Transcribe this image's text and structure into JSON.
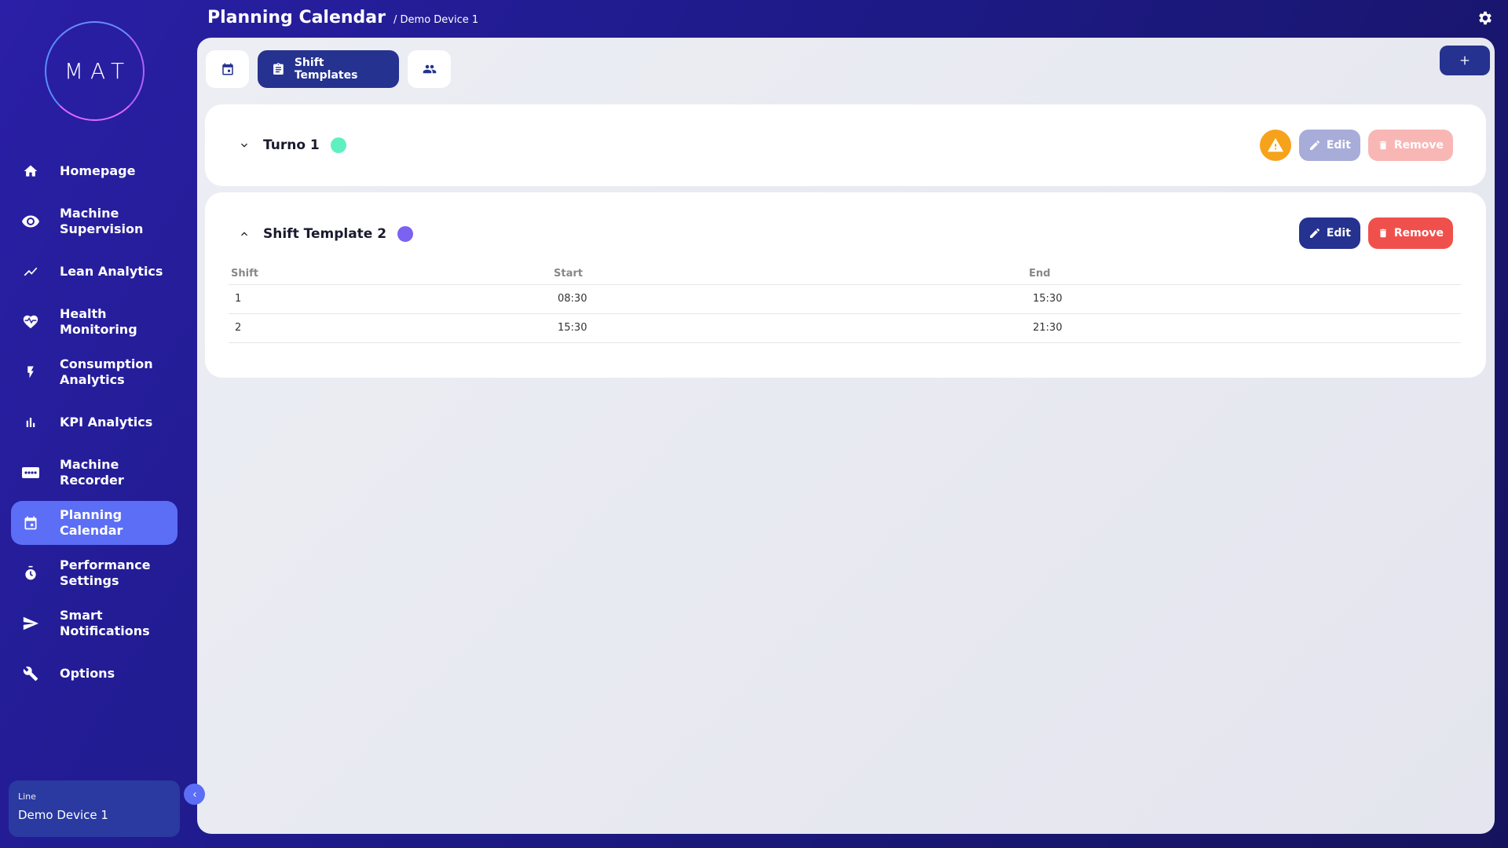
{
  "logo_text": "MAT",
  "sidebar": {
    "items": [
      {
        "label": "Homepage",
        "icon": "home-icon"
      },
      {
        "label": "Machine Supervision",
        "icon": "eye-icon"
      },
      {
        "label": "Lean Analytics",
        "icon": "trend-line-icon"
      },
      {
        "label": "Health Monitoring",
        "icon": "heart-pulse-icon"
      },
      {
        "label": "Consumption Analytics",
        "icon": "lightning-icon"
      },
      {
        "label": "KPI Analytics",
        "icon": "bar-chart-icon"
      },
      {
        "label": "Machine Recorder",
        "icon": "recorder-icon"
      },
      {
        "label": "Planning Calendar",
        "icon": "calendar-icon",
        "active": true
      },
      {
        "label": "Performance Settings",
        "icon": "timer-icon"
      },
      {
        "label": "Smart Notifications",
        "icon": "send-icon"
      },
      {
        "label": "Options",
        "icon": "wrench-icon"
      }
    ],
    "device": {
      "label": "Line",
      "value": "Demo Device 1"
    }
  },
  "header": {
    "title": "Planning Calendar",
    "subtitle": "/ Demo Device 1"
  },
  "tabs": [
    {
      "icon": "calendar-icon"
    },
    {
      "label": "Shift Templates",
      "icon": "clipboard-icon",
      "active": true
    },
    {
      "icon": "people-icon"
    }
  ],
  "templates": [
    {
      "name": "Turno 1",
      "color": "#5ef0c0",
      "expanded": false,
      "warning": true,
      "edit_label": "Edit",
      "remove_label": "Remove"
    },
    {
      "name": "Shift Template 2",
      "color": "#7b62f0",
      "expanded": true,
      "edit_label": "Edit",
      "remove_label": "Remove",
      "columns": [
        "Shift",
        "Start",
        "End"
      ],
      "rows": [
        [
          "1",
          "08:30",
          "15:30"
        ],
        [
          "2",
          "15:30",
          "21:30"
        ]
      ]
    }
  ],
  "colors": {
    "accent": "#25328f",
    "active_nav": "#5b6ef5",
    "remove": "#f0504c",
    "warning": "#f7a21b"
  }
}
